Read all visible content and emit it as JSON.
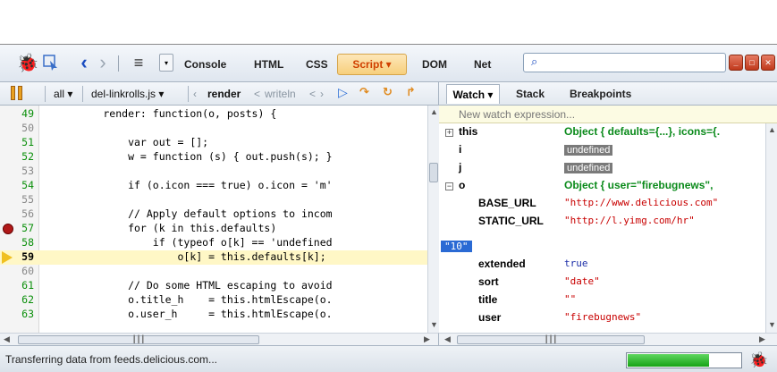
{
  "toolbar": {
    "tabs": [
      "Console",
      "HTML",
      "CSS",
      "Script ▾",
      "DOM",
      "Net"
    ],
    "active_tab": "Script ▾",
    "search_value": ""
  },
  "script_toolbar": {
    "scope": "all ▾",
    "file": "del-linkrolls.js ▾",
    "stack_current": "render",
    "stack_prev": "writeln"
  },
  "code_lines": [
    {
      "num": "49",
      "text": "        render: function(o, posts) {"
    },
    {
      "num": "50",
      "text": ""
    },
    {
      "num": "51",
      "text": "            var out = [];"
    },
    {
      "num": "52",
      "text": "            w = function (s) { out.push(s); }"
    },
    {
      "num": "53",
      "text": ""
    },
    {
      "num": "54",
      "text": "            if (o.icon === true) o.icon = 'm'"
    },
    {
      "num": "55",
      "text": ""
    },
    {
      "num": "56",
      "text": "            // Apply default options to incom"
    },
    {
      "num": "57",
      "text": "            for (k in this.defaults)"
    },
    {
      "num": "58",
      "text": "                if (typeof o[k] == 'undefined"
    },
    {
      "num": "59",
      "text": "                    o[k] = this.defaults[k];"
    },
    {
      "num": "60",
      "text": ""
    },
    {
      "num": "61",
      "text": "            // Do some HTML escaping to avoid"
    },
    {
      "num": "62",
      "text": "            o.title_h    = this.htmlEscape(o."
    },
    {
      "num": "63",
      "text": "            o.user_h     = this.htmlEscape(o."
    }
  ],
  "watch": {
    "tabs": [
      "Watch ▾",
      "Stack",
      "Breakpoints"
    ],
    "new_expression_placeholder": "New watch expression...",
    "rows": [
      {
        "key": "this",
        "value": "Object { defaults={...},  icons={."
      },
      {
        "key": "i",
        "value": "undefined"
      },
      {
        "key": "j",
        "value": "undefined"
      },
      {
        "key": "o",
        "value": "Object { user=\"firebugnews\","
      },
      {
        "key": "BASE_URL",
        "value": "\"http://www.delicious.com\""
      },
      {
        "key": "STATIC_URL",
        "value": "\"http://l.yimg.com/hr\""
      },
      {
        "key": "extended",
        "value": "true"
      },
      {
        "key": "sort",
        "value": "\"date\""
      },
      {
        "key": "title",
        "value": "\"\""
      },
      {
        "key": "user",
        "value": "\"firebugnews\""
      }
    ],
    "selected_value": "\"10\""
  },
  "status": {
    "text": "Transferring data from feeds.delicious.com...",
    "progress": 0.72
  }
}
